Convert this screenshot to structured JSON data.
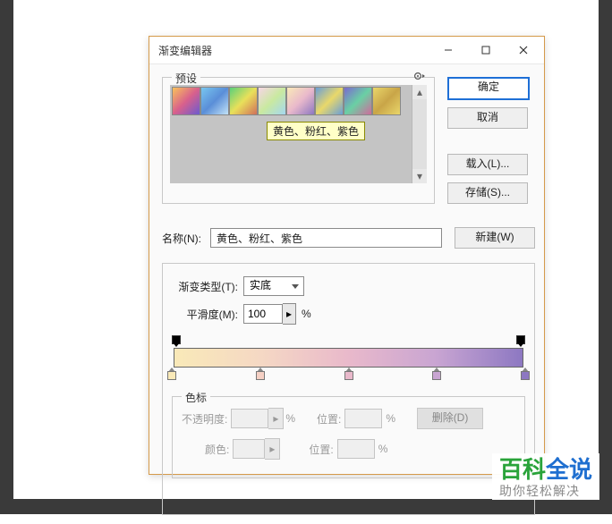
{
  "dialog": {
    "title": "渐变编辑器",
    "presets_label": "预设",
    "tooltip": "黄色、粉红、紫色",
    "buttons": {
      "ok": "确定",
      "cancel": "取消",
      "load": "载入(L)...",
      "save": "存储(S)...",
      "new": "新建(W)",
      "delete": "删除(D)"
    },
    "name_label": "名称(N):",
    "name_value": "黄色、粉红、紫色",
    "type_label": "渐变类型(T):",
    "type_value": "实底",
    "smooth_label": "平滑度(M):",
    "smooth_value": "100",
    "percent": "%",
    "stops_label": "色标",
    "opacity_label": "不透明度:",
    "position_label": "位置:",
    "color_label": "颜色:"
  },
  "presets": [
    "linear-gradient(135deg,#f8c25a,#d9608c,#6a5bd0)",
    "linear-gradient(135deg,#78c6ef,#5a8ed8,#c2e2f7)",
    "linear-gradient(135deg,#5ad07a,#e9e05a,#d0705a)",
    "linear-gradient(135deg,#f7d6e6,#c9e9a0,#a4d8f0)",
    "linear-gradient(135deg,#f9e9b8,#e9b9cb,#8d78c2)",
    "linear-gradient(135deg,#6a9ed8,#e9d86a,#6a9ed8)",
    "linear-gradient(135deg,#7a6ad0,#6ad0a4,#d06a9c)",
    "linear-gradient(135deg,#e9d66a,#c9a548,#e9d66a)"
  ],
  "color_stops": [
    {
      "pos": 0,
      "color": "#f9e9b8"
    },
    {
      "pos": 25,
      "color": "#f5d0c4"
    },
    {
      "pos": 50,
      "color": "#e9b9cb"
    },
    {
      "pos": 75,
      "color": "#c9a5d2"
    },
    {
      "pos": 100,
      "color": "#8d78c2"
    }
  ],
  "watermark": {
    "line1a": "百科",
    "line1b": "全说",
    "line2": "助你轻松解决"
  }
}
